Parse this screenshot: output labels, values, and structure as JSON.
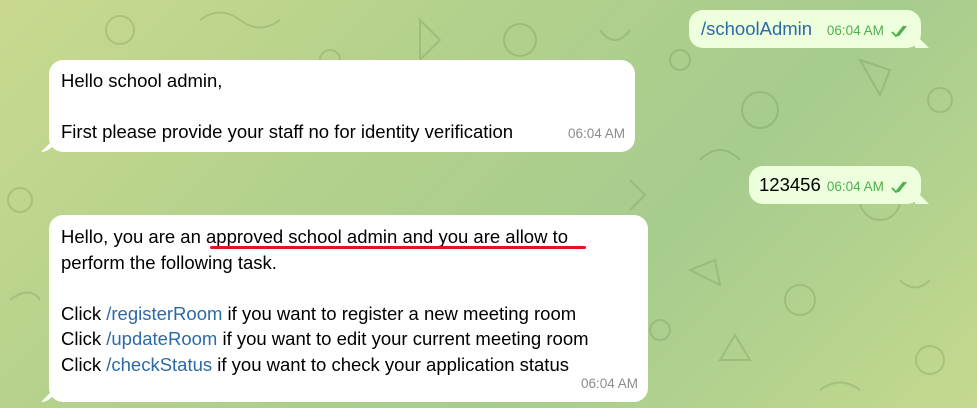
{
  "messages": [
    {
      "direction": "out",
      "text": "/schoolAdmin",
      "time": "06:04 AM"
    },
    {
      "direction": "in",
      "line1": "Hello school admin,",
      "line2": "First please provide your staff no for identity verification",
      "time": "06:04 AM"
    },
    {
      "direction": "out",
      "text": "123456",
      "time": "06:04 AM"
    },
    {
      "direction": "in",
      "p1_before": "Hello, you are an ",
      "p1_underlined": "approved school admin and you are allow",
      "p1_after": " to",
      "p2": "perform the following task.",
      "rows": [
        {
          "prefix": "Click ",
          "cmd": "/registerRoom",
          "suffix": " if you want to register a new meeting room"
        },
        {
          "prefix": "Click ",
          "cmd": "/updateRoom",
          "suffix": " if you want to edit your current meeting room"
        },
        {
          "prefix": "Click ",
          "cmd": "/checkStatus",
          "suffix": " if you want to check your application status"
        }
      ],
      "time": "06:04 AM"
    }
  ],
  "colors": {
    "link": "#2c6aa6",
    "read_ticks": "#4fae4e",
    "annotation_underline": "#e0161c"
  },
  "icons": {
    "read": "double-check-icon"
  }
}
